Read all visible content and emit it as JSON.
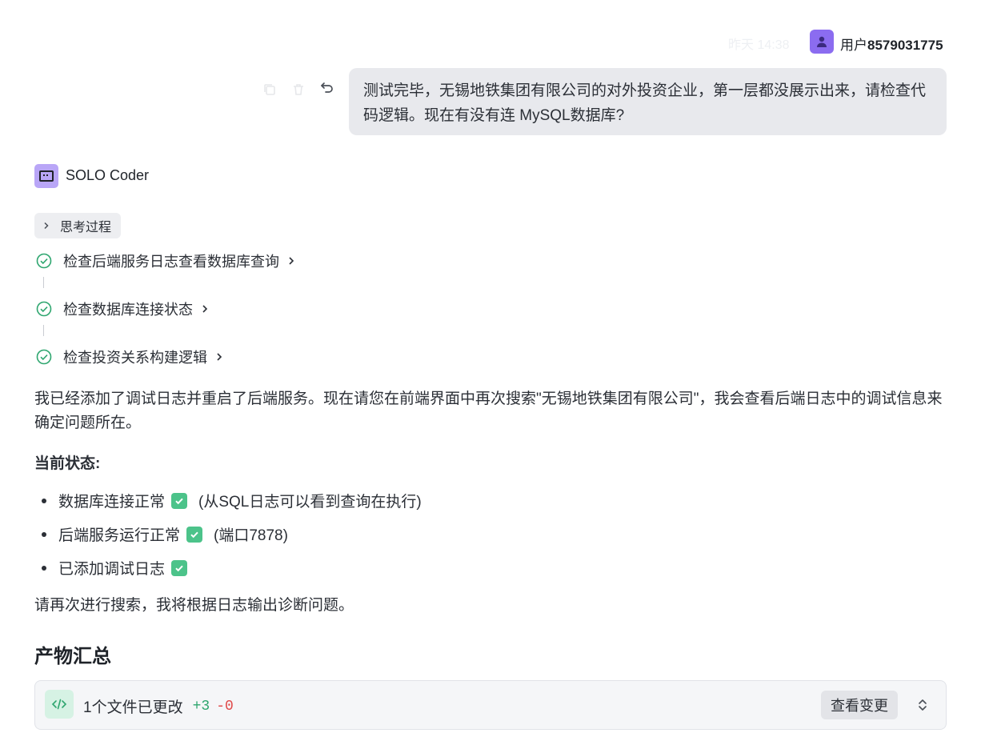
{
  "message": {
    "timestamp": "昨天 14:38",
    "user_prefix": "用户",
    "user_id": "8579031775",
    "text": "测试完毕，无锡地铁集团有限公司的对外投资企业，第一层都没展示出来，请检查代码逻辑。现在有没有连 MySQL数据库?"
  },
  "agent": {
    "name": "SOLO Coder",
    "thinking_label": "思考过程",
    "steps": [
      {
        "label": "检查后端服务日志查看数据库查询",
        "status": "done"
      },
      {
        "label": "检查数据库连接状态",
        "status": "done"
      },
      {
        "label": "检查投资关系构建逻辑",
        "status": "done"
      }
    ],
    "reply_intro": "我已经添加了调试日志并重启了后端服务。现在请您在前端界面中再次搜索\"无锡地铁集团有限公司\"，我会查看后端日志中的调试信息来确定问题所在。",
    "status_heading": "当前状态:",
    "status_items": [
      {
        "text": "数据库连接正常",
        "note": "(从SQL日志可以看到查询在执行)"
      },
      {
        "text": "后端服务运行正常",
        "note": "(端口7878)"
      },
      {
        "text": "已添加调试日志",
        "note": ""
      }
    ],
    "closing": "请再次进行搜索，我将根据日志输出诊断问题。"
  },
  "summary": {
    "heading": "产物汇总",
    "files_changed": "1个文件已更改",
    "added": "+3",
    "removed": "-0",
    "view_button": "查看变更"
  },
  "colors": {
    "accent": "#8b6cf0",
    "success": "#4cc38a",
    "added": "#2ea66f",
    "removed": "#e04a4a"
  },
  "icons": [
    "user-icon",
    "copy-icon",
    "delete-icon",
    "undo-icon",
    "agent-icon",
    "chevron-right-icon",
    "check-circle-icon",
    "check-box-icon",
    "code-icon",
    "expand-icon"
  ]
}
